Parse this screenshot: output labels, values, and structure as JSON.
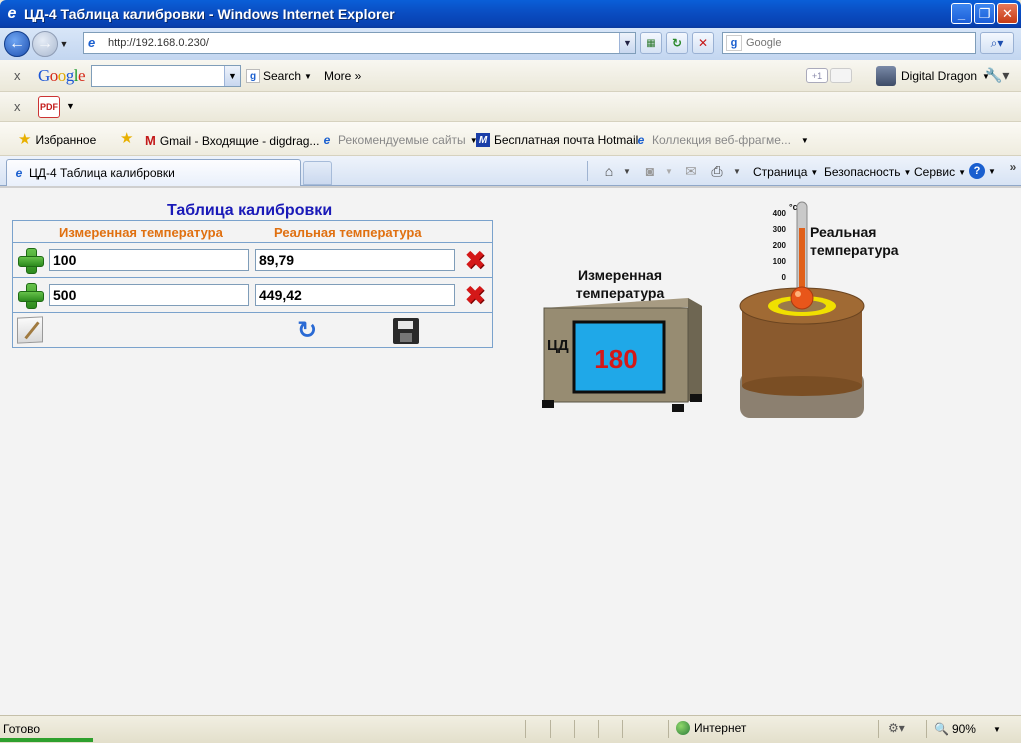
{
  "window": {
    "title": "ЦД-4 Таблица калибровки - Windows Internet Explorer",
    "minimize": "_",
    "maximize": "❐",
    "close": "✕"
  },
  "address_bar": {
    "url": "http://192.168.0.230/",
    "search_placeholder": "Google"
  },
  "google_toolbar": {
    "close": "x",
    "logo": [
      "G",
      "o",
      "o",
      "g",
      "l",
      "e"
    ],
    "search_label": "Search",
    "more_label": "More »",
    "plus_one": "+1",
    "user_name": "Digital Dragon"
  },
  "pdf_toolbar": {
    "close": "x",
    "pdf_icon": "PDF"
  },
  "favorites_bar": {
    "favorites_label": "Избранное",
    "items": [
      {
        "label": "Gmail - Входящие - digdrag..."
      },
      {
        "label": "Рекомендуемые сайты"
      },
      {
        "label": "Бесплатная почта Hotmail"
      },
      {
        "label": "Коллекция веб-фрагме..."
      }
    ]
  },
  "tabs": {
    "active_tab": "ЦД-4 Таблица калибровки"
  },
  "command_bar": {
    "page": "Страница",
    "safety": "Безопасность",
    "tools": "Сервис",
    "help": "?"
  },
  "calibration": {
    "title": "Таблица калибровки",
    "col_measured": "Измеренная температура",
    "col_real": "Реальная температура",
    "rows": [
      {
        "measured": "100",
        "real": "89,79"
      },
      {
        "measured": "500",
        "real": "449,42"
      }
    ]
  },
  "illustration": {
    "device_label_line1": "Измеренная",
    "device_label_line2": "температура",
    "device_brand": "ЦД",
    "device_reading": "180",
    "thermo_label_line1": "Реальная",
    "thermo_label_line2": "температура",
    "thermo_unit": "°c",
    "thermo_ticks": [
      "400",
      "300",
      "200",
      "100",
      "0"
    ]
  },
  "status_bar": {
    "status": "Готово",
    "zone": "Интернет",
    "zoom": "90%"
  },
  "colors": {
    "calib_title": "#1a1ab8",
    "column_header": "#e07010",
    "device_reading": "#d41818",
    "device_screen": "#1fa8e8"
  }
}
